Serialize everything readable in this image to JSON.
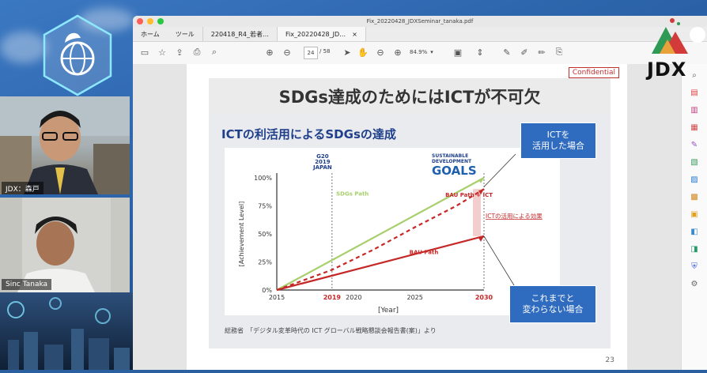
{
  "participants": [
    {
      "label": "JDX：森戸"
    },
    {
      "label": "Sinc Tanaka"
    }
  ],
  "brand": {
    "text": "JDX"
  },
  "window": {
    "title": "Fix_20220428_JDXSeminar_tanaka.pdf"
  },
  "tabs": {
    "home": "ホーム",
    "tools": "ツール",
    "doc1": "220418_R4_若者…",
    "doc2": "Fix_20220428_JD…",
    "close": "×"
  },
  "toolbar": {
    "page_current": "24",
    "page_total": "/ 58",
    "zoom": "84.9%"
  },
  "slide": {
    "confidential": "Confidential",
    "title": "SDGs達成のためにはICTが不可欠",
    "subtitle": "ICTの利活用によるSDGsの達成",
    "g20": [
      "G20",
      "2019",
      "JAPAN"
    ],
    "sdg_logo": [
      "SUSTAINABLE",
      "DEVELOPMENT"
    ],
    "sdg_goals": "GOALS",
    "callout_top": [
      "ICTを",
      "活用した場合"
    ],
    "callout_bottom": [
      "これまでと",
      "変わらない場合"
    ],
    "source": "総務省　「デジタル変革時代の ICT グローバル戦略懇談会報告書(案)」より",
    "page_number": "23"
  },
  "chart_data": {
    "type": "line",
    "ylabel": "[Achievement Level]",
    "xlabel": "[Year]",
    "xlim": [
      2015,
      2030
    ],
    "ylim": [
      0,
      100
    ],
    "x_ticks": [
      "2015",
      "2019",
      "2020",
      "2025",
      "2030"
    ],
    "x_ticks_highlight": [
      "2019",
      "2030"
    ],
    "y_ticks": [
      "0%",
      "25%",
      "50%",
      "75%",
      "100%"
    ],
    "series": [
      {
        "name": "SDGs Path",
        "color": "#a7cf6b",
        "style": "solid",
        "points": [
          [
            2015,
            0
          ],
          [
            2030,
            100
          ]
        ]
      },
      {
        "name": "BAU Path + ICT",
        "color": "#c62828",
        "style": "dashed",
        "points": [
          [
            2015,
            0
          ],
          [
            2019,
            18
          ],
          [
            2022,
            36
          ],
          [
            2025,
            56
          ],
          [
            2028,
            75
          ],
          [
            2030,
            90
          ]
        ]
      },
      {
        "name": "BAU Path",
        "color": "#c62828",
        "style": "solid",
        "points": [
          [
            2015,
            0
          ],
          [
            2030,
            48
          ]
        ]
      }
    ],
    "annotations": [
      {
        "text": "ICTの活用による効果",
        "color": "#c62828"
      }
    ],
    "vlines": [
      2019,
      2030
    ],
    "grid": false
  }
}
